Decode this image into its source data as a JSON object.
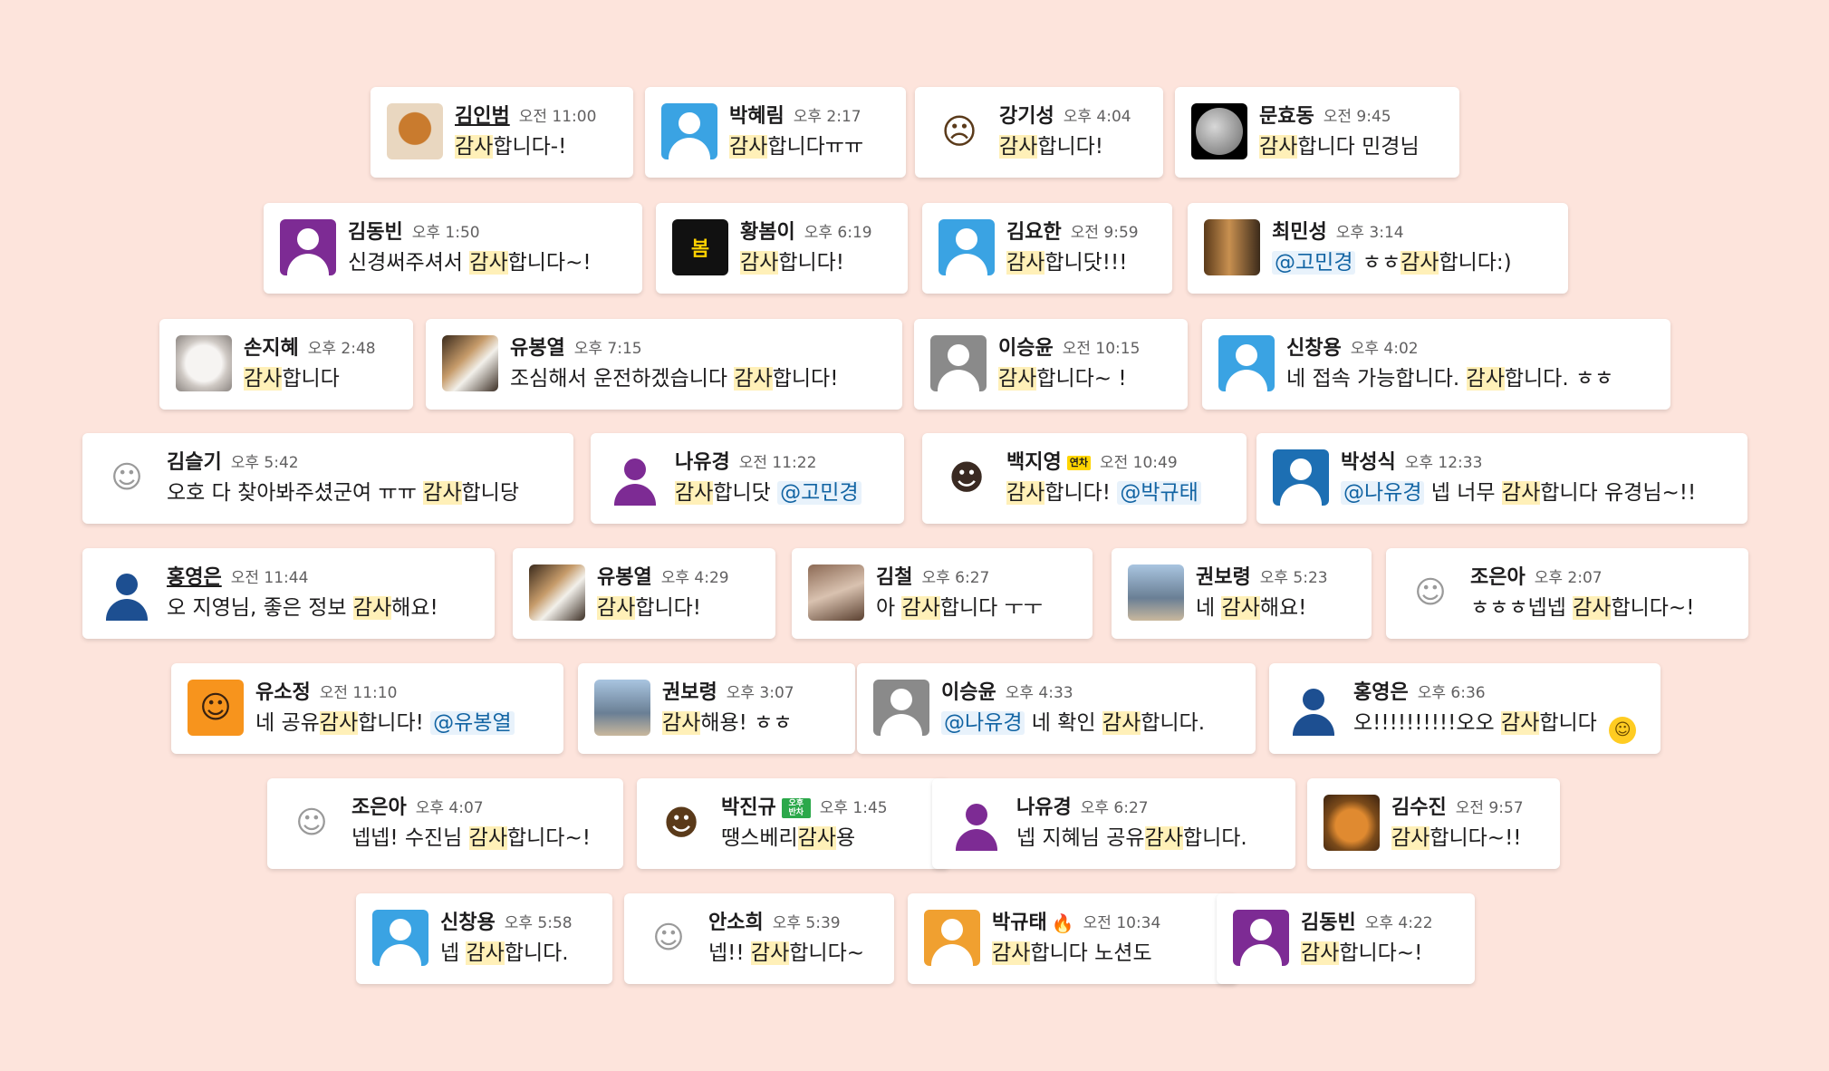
{
  "rows": [
    [
      {
        "name": "김인범",
        "time": "오전 11:00",
        "msg": [
          {
            "t": "감사",
            "h": 1
          },
          {
            "t": "합니다-!"
          }
        ],
        "avatar": "dog-photo-icon"
      },
      {
        "name": "박혜림",
        "time": "오후 2:17",
        "msg": [
          {
            "t": "감사",
            "h": 1
          },
          {
            "t": "합니다ㅠㅠ"
          }
        ],
        "avatar": "default-user-icon"
      },
      {
        "name": "강기성",
        "time": "오후 4:04",
        "msg": [
          {
            "t": "감사",
            "h": 1
          },
          {
            "t": "합니다!"
          }
        ],
        "avatar": "thinking-face-icon"
      },
      {
        "name": "문효동",
        "time": "오전 9:45",
        "msg": [
          {
            "t": "감사",
            "h": 1
          },
          {
            "t": "합니다 민경님"
          }
        ],
        "avatar": "moon-photo-icon"
      }
    ],
    [
      {
        "name": "김동빈",
        "time": "오후 1:50",
        "msg": [
          {
            "t": "신경써주셔서 "
          },
          {
            "t": "감사",
            "h": 1
          },
          {
            "t": "합니다~!"
          }
        ],
        "avatar": "purple-user-icon"
      },
      {
        "name": "황봄이",
        "time": "오후 6:19",
        "msg": [
          {
            "t": "감사",
            "h": 1
          },
          {
            "t": "합니다!"
          }
        ],
        "avatar": "spring-badge-icon",
        "avatar_text": "봄"
      },
      {
        "name": "김요한",
        "time": "오전 9:59",
        "msg": [
          {
            "t": "감사",
            "h": 1
          },
          {
            "t": "합니닷!!!"
          }
        ],
        "avatar": "default-user-icon"
      },
      {
        "name": "최민성",
        "time": "오후 3:14",
        "msg": [
          {
            "t": "@고민경",
            "m": 1
          },
          {
            "t": " ㅎㅎ"
          },
          {
            "t": "감사",
            "h": 1
          },
          {
            "t": "합니다:)"
          }
        ],
        "avatar": "birds-photo-icon"
      }
    ],
    [
      {
        "name": "손지혜",
        "time": "오후 2:48",
        "msg": [
          {
            "t": "감사",
            "h": 1
          },
          {
            "t": "합니다"
          }
        ],
        "avatar": "fluffy-dog-photo-icon"
      },
      {
        "name": "유봉열",
        "time": "오후 7:15",
        "msg": [
          {
            "t": "조심해서 운전하겠습니다 "
          },
          {
            "t": "감사",
            "h": 1
          },
          {
            "t": "합니다!"
          }
        ],
        "avatar": "cat-photo-icon"
      },
      {
        "name": "이승윤",
        "time": "오전 10:15",
        "msg": [
          {
            "t": "감사",
            "h": 1
          },
          {
            "t": "합니다~ !"
          }
        ],
        "avatar": "gray-user-icon"
      },
      {
        "name": "신창용",
        "time": "오후 4:02",
        "msg": [
          {
            "t": "네 접속 가능합니다. "
          },
          {
            "t": "감사",
            "h": 1
          },
          {
            "t": "합니다. ㅎㅎ"
          }
        ],
        "avatar": "default-user-icon"
      }
    ],
    [
      {
        "name": "김슬기",
        "time": "오후 5:42",
        "msg": [
          {
            "t": "오호 다 찾아봐주셨군여 ㅠㅠ "
          },
          {
            "t": "감사",
            "h": 1
          },
          {
            "t": "합니당"
          }
        ],
        "avatar": "line-drawing-face-icon"
      },
      {
        "name": "나유경",
        "time": "오전 11:22",
        "msg": [
          {
            "t": "감사",
            "h": 1
          },
          {
            "t": "합니닷 "
          },
          {
            "t": "@고민경",
            "m": 1
          }
        ],
        "avatar": "purple-person-icon"
      },
      {
        "name": "백지영",
        "time": "오전 10:49",
        "badge": "연차",
        "msg": [
          {
            "t": "감사",
            "h": 1
          },
          {
            "t": "합니다! "
          },
          {
            "t": "@박규태",
            "m": 1
          }
        ],
        "avatar": "cartoon-girl-icon"
      },
      {
        "name": "박성식",
        "time": "오후 12:33",
        "msg": [
          {
            "t": "@나유경",
            "m": 1
          },
          {
            "t": " 넵 너무 "
          },
          {
            "t": "감사",
            "h": 1
          },
          {
            "t": "합니다 유경님~!!"
          }
        ],
        "avatar": "blue-user-icon"
      }
    ],
    [
      {
        "name": "홍영은",
        "time": "오전 11:44",
        "msg": [
          {
            "t": "오 지영님, 좋은 정보 "
          },
          {
            "t": "감사",
            "h": 1
          },
          {
            "t": "해요!"
          }
        ],
        "avatar": "navy-person-icon"
      },
      {
        "name": "유봉열",
        "time": "오후 4:29",
        "msg": [
          {
            "t": "감사",
            "h": 1
          },
          {
            "t": "합니다!"
          }
        ],
        "avatar": "cat-photo-icon"
      },
      {
        "name": "김철",
        "time": "오후 6:27",
        "msg": [
          {
            "t": "아 "
          },
          {
            "t": "감사",
            "h": 1
          },
          {
            "t": "합니다 ㅜㅜ"
          }
        ],
        "avatar": "people-photo-icon"
      },
      {
        "name": "권보령",
        "time": "오후 5:23",
        "msg": [
          {
            "t": "네 "
          },
          {
            "t": "감사",
            "h": 1
          },
          {
            "t": "해요!"
          }
        ],
        "avatar": "dog-street-photo-icon"
      },
      {
        "name": "조은아",
        "time": "오후 2:07",
        "msg": [
          {
            "t": "ㅎㅎㅎ넵넵 "
          },
          {
            "t": "감사",
            "h": 1
          },
          {
            "t": "합니다~!"
          }
        ],
        "avatar": "line-drawing-face-icon"
      }
    ],
    [
      {
        "name": "유소정",
        "time": "오전 11:10",
        "msg": [
          {
            "t": "네 공유"
          },
          {
            "t": "감사",
            "h": 1
          },
          {
            "t": "합니다! "
          },
          {
            "t": "@유봉열",
            "m": 1
          }
        ],
        "avatar": "orange-cartoon-icon"
      },
      {
        "name": "권보령",
        "time": "오후 3:07",
        "msg": [
          {
            "t": "감사",
            "h": 1
          },
          {
            "t": "해용! ㅎㅎ"
          }
        ],
        "avatar": "dog-street-photo-icon"
      },
      {
        "name": "이승윤",
        "time": "오후 4:33",
        "msg": [
          {
            "t": "@나유경",
            "m": 1
          },
          {
            "t": " 네 확인 "
          },
          {
            "t": "감사",
            "h": 1
          },
          {
            "t": "합니다."
          }
        ],
        "avatar": "gray-user-icon"
      },
      {
        "name": "홍영은",
        "time": "오후 6:36",
        "msg": [
          {
            "t": "오!!!!!!!!!!오오 "
          },
          {
            "t": "감사",
            "h": 1
          },
          {
            "t": "합니다 "
          }
        ],
        "smile": 1,
        "avatar": "navy-person-icon"
      }
    ],
    [
      {
        "name": "조은아",
        "time": "오후 4:07",
        "msg": [
          {
            "t": "넵넵! 수진님 "
          },
          {
            "t": "감사",
            "h": 1
          },
          {
            "t": "합니다~!"
          }
        ],
        "avatar": "line-drawing-face-icon"
      },
      {
        "name": "박진규",
        "time": "오후 1:45",
        "badge2": "오후 반차",
        "msg": [
          {
            "t": "땡스베리"
          },
          {
            "t": "감사",
            "h": 1
          },
          {
            "t": "용"
          }
        ],
        "avatar": "emoji-man-icon"
      },
      {
        "name": "나유경",
        "time": "오후 6:27",
        "msg": [
          {
            "t": "넵 지혜님 공유"
          },
          {
            "t": "감사",
            "h": 1
          },
          {
            "t": "합니다."
          }
        ],
        "avatar": "purple-person-icon"
      },
      {
        "name": "김수진",
        "time": "오전 9:57",
        "msg": [
          {
            "t": "감사",
            "h": 1
          },
          {
            "t": "합니다~!!"
          }
        ],
        "avatar": "garfield-photo-icon"
      }
    ],
    [
      {
        "name": "신창용",
        "time": "오후 5:58",
        "msg": [
          {
            "t": "넵 "
          },
          {
            "t": "감사",
            "h": 1
          },
          {
            "t": "합니다."
          }
        ],
        "avatar": "default-user-icon"
      },
      {
        "name": "안소희",
        "time": "오후 5:39",
        "msg": [
          {
            "t": "넵!! "
          },
          {
            "t": "감사",
            "h": 1
          },
          {
            "t": "합니다~"
          }
        ],
        "avatar": "line-drawing-face-icon"
      },
      {
        "name": "박규태",
        "time": "오전 10:34",
        "fire": "🔥",
        "msg": [
          {
            "t": "감사",
            "h": 1
          },
          {
            "t": "합니다 노션도"
          }
        ],
        "avatar": "orange-user-icon"
      },
      {
        "name": "김동빈",
        "time": "오후 4:22",
        "msg": [
          {
            "t": "감사",
            "h": 1
          },
          {
            "t": "합니다~!"
          }
        ],
        "avatar": "purple-user-icon"
      }
    ]
  ]
}
